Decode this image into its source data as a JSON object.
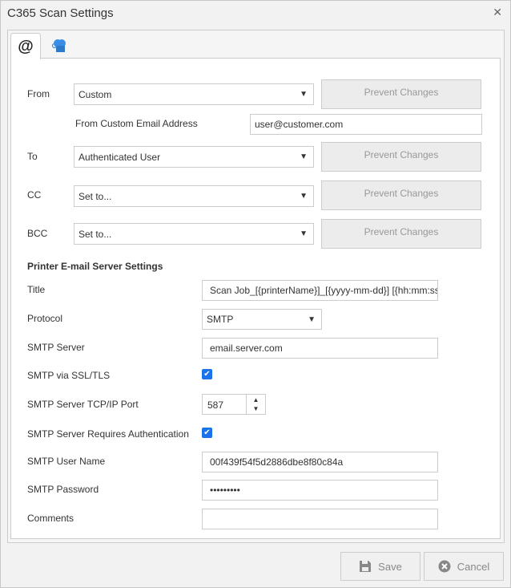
{
  "window": {
    "title": "C365 Scan Settings"
  },
  "tabs": [
    {
      "icon": "at-icon",
      "label": "@"
    },
    {
      "icon": "cloud-printer-icon"
    }
  ],
  "email": {
    "from": {
      "label": "From",
      "value": "Custom",
      "prevent": "Prevent Changes"
    },
    "from_custom": {
      "label": "From Custom Email Address",
      "value": "user@customer.com"
    },
    "to": {
      "label": "To",
      "value": "Authenticated User",
      "prevent": "Prevent Changes"
    },
    "cc": {
      "label": "CC",
      "value": "Set to...",
      "prevent": "Prevent Changes"
    },
    "bcc": {
      "label": "BCC",
      "value": "Set to...",
      "prevent": "Prevent Changes"
    }
  },
  "server": {
    "heading": "Printer E-mail Server Settings",
    "title": {
      "label": "Title",
      "value": "Scan Job_[{printerName}]_[{yyyy-mm-dd}] [{hh:mm:ss}]"
    },
    "protocol": {
      "label": "Protocol",
      "value": "SMTP"
    },
    "smtp_server": {
      "label": "SMTP Server",
      "value": "email.server.com"
    },
    "ssl": {
      "label": "SMTP via SSL/TLS",
      "checked": true
    },
    "port": {
      "label": "SMTP Server TCP/IP Port",
      "value": "587"
    },
    "auth": {
      "label": "SMTP Server Requires Authentication",
      "checked": true
    },
    "username": {
      "label": "SMTP User Name",
      "value": "00f439f54f5d2886dbe8f80c84a"
    },
    "password": {
      "label": "SMTP Password",
      "value": "•••••••••"
    },
    "comments": {
      "label": "Comments",
      "value": ""
    }
  },
  "footer": {
    "save": "Save",
    "cancel": "Cancel"
  }
}
